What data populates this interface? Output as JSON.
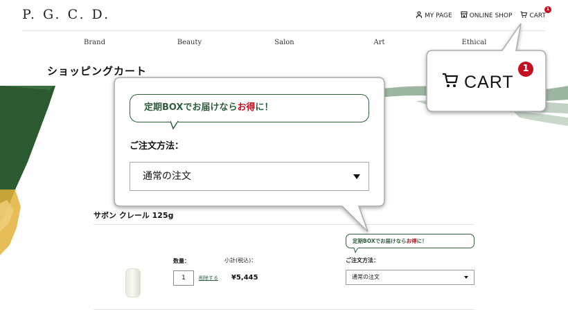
{
  "header": {
    "logo": "P. G. C. D.",
    "util_nav": [
      {
        "label": "MY PAGE",
        "icon": "person-icon"
      },
      {
        "label": "ONLINE SHOP",
        "icon": "shop-icon"
      },
      {
        "label": "CART",
        "icon": "cart-icon",
        "badge": "1"
      }
    ],
    "global_nav": [
      "Brand",
      "Beauty",
      "Salon",
      "Art",
      "Ethical"
    ]
  },
  "page": {
    "title": "ショッピングカート"
  },
  "product": {
    "name": "サボン クレール 125g",
    "quantity_label": "数量：",
    "quantity": "1",
    "delete_label": "削除する",
    "subtotal_label": "小計(税込)：",
    "subtotal": "¥5,445",
    "promo_pre": "定期BOXでお届けなら",
    "promo_highlight": "お得",
    "promo_post": "に！",
    "order_method_label": "ご注文方法：",
    "order_method_value": "通常の注文"
  },
  "zoom_cart": {
    "label": "CART",
    "badge": "1"
  },
  "zoom_order": {
    "promo_pre": "定期BOXでお届けなら",
    "promo_highlight": "お得",
    "promo_post": "に！",
    "order_method_label": "ご注文方法：",
    "order_method_value": "通常の注文"
  },
  "colors": {
    "accent_green": "#2f5e3d",
    "badge_red": "#c4101e",
    "brush_green": "#2b5a30",
    "brush_gold": "#e2b23a"
  }
}
